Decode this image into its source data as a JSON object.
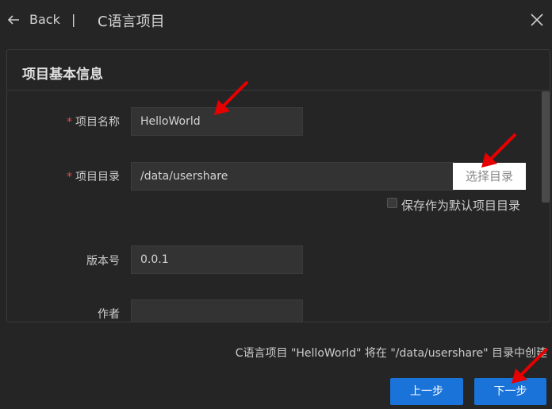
{
  "header": {
    "back_label": "Back",
    "separator": "|",
    "title": "C语言项目"
  },
  "panel": {
    "title": "项目基本信息",
    "fields": [
      {
        "label": "项目名称",
        "required": true,
        "value": "HelloWorld"
      },
      {
        "label": "项目目录",
        "required": true,
        "value": "/data/usershare"
      },
      {
        "label": "版本号",
        "required": false,
        "value": "0.0.1"
      },
      {
        "label": "作者",
        "required": false,
        "value": ""
      }
    ],
    "choose_dir_label": "选择目录",
    "save_default_label": "保存作为默认项目目录",
    "required_mark": "*"
  },
  "footer": {
    "note": "C语言项目 \"HelloWorld\" 将在 \"/data/usershare\" 目录中创建",
    "prev_label": "上一步",
    "next_label": "下一步"
  },
  "colors": {
    "background": "#252526",
    "primary_button": "#1a73d9",
    "required": "#e84a4a",
    "annotation_arrow": "#e60000"
  }
}
